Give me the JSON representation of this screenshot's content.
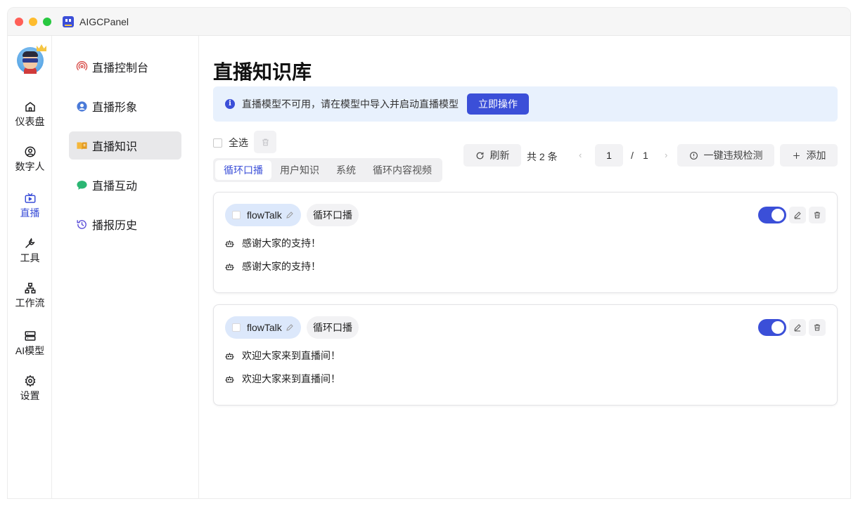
{
  "app": {
    "title": "AIGCPanel"
  },
  "rail": {
    "items": [
      {
        "label": "仪表盘",
        "icon": "home-icon"
      },
      {
        "label": "数字人",
        "icon": "user-circle-icon"
      },
      {
        "label": "直播",
        "icon": "tv-icon",
        "active": true
      },
      {
        "label": "工具",
        "icon": "wrench-icon"
      },
      {
        "label": "工作流",
        "icon": "workflow-icon"
      },
      {
        "label": "AI模型",
        "icon": "server-icon"
      },
      {
        "label": "设置",
        "icon": "gear-icon"
      }
    ]
  },
  "subnav": {
    "items": [
      {
        "label": "直播控制台",
        "icon": "broadcast-icon"
      },
      {
        "label": "直播形象",
        "icon": "user-icon"
      },
      {
        "label": "直播知识",
        "icon": "book-icon",
        "active": true
      },
      {
        "label": "直播互动",
        "icon": "chat-icon"
      },
      {
        "label": "播报历史",
        "icon": "history-icon"
      }
    ]
  },
  "page": {
    "title": "直播知识库"
  },
  "alert": {
    "text": "直播模型不可用，请在模型中导入并启动直播模型",
    "button": "立即操作"
  },
  "select_all": "全选",
  "tabs": [
    {
      "label": "循环口播",
      "active": true
    },
    {
      "label": "用户知识"
    },
    {
      "label": "系统"
    },
    {
      "label": "循环内容视频"
    }
  ],
  "toolbar": {
    "refresh": "刷新",
    "total": "共 2 条",
    "page_current": "1",
    "page_sep": "/",
    "page_total": "1",
    "check": "一键违规检测",
    "add": "添加"
  },
  "colors": {
    "accent": "#3b4fd8",
    "alert_bg": "#e8f1fd",
    "user_chip_bg": "#dce8fb"
  },
  "cards": [
    {
      "user": "flowTalk",
      "type": "循环口播",
      "enabled": true,
      "lines": [
        "感谢大家的支持！",
        "感谢大家的支持！"
      ]
    },
    {
      "user": "flowTalk",
      "type": "循环口播",
      "enabled": true,
      "lines": [
        "欢迎大家来到直播间！",
        "欢迎大家来到直播间！"
      ]
    }
  ]
}
